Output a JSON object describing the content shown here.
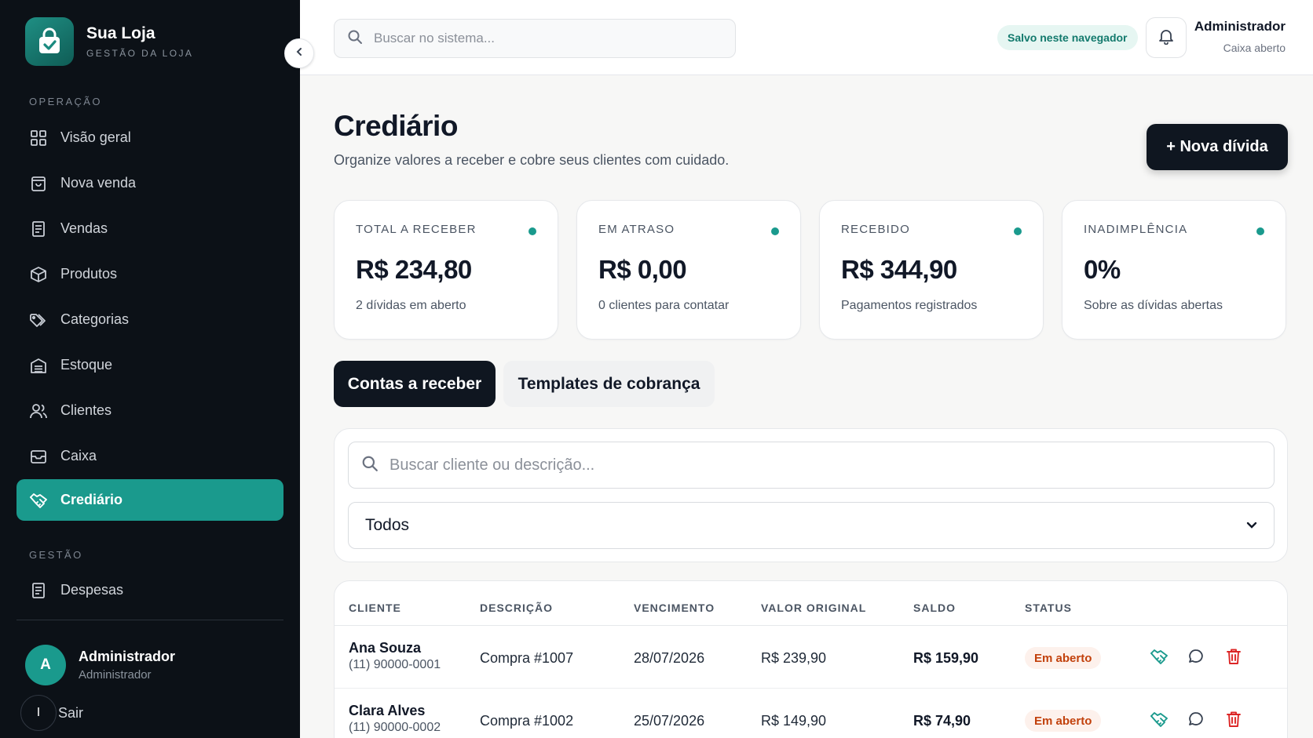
{
  "brand": {
    "name": "Sua Loja",
    "subtitle": "GESTÃO DA LOJA"
  },
  "sidebar": {
    "section_operacao": "OPERAÇÃO",
    "section_gestao": "GESTÃO",
    "items": [
      {
        "label": "Visão geral",
        "icon": "grid-icon"
      },
      {
        "label": "Nova venda",
        "icon": "shopping-bag-icon"
      },
      {
        "label": "Vendas",
        "icon": "receipt-icon"
      },
      {
        "label": "Produtos",
        "icon": "box-icon"
      },
      {
        "label": "Categorias",
        "icon": "tags-icon"
      },
      {
        "label": "Estoque",
        "icon": "warehouse-icon"
      },
      {
        "label": "Clientes",
        "icon": "users-icon"
      },
      {
        "label": "Caixa",
        "icon": "cash-register-icon"
      },
      {
        "label": "Crediário",
        "icon": "handshake-icon",
        "active": true
      }
    ],
    "gestao_items": [
      {
        "label": "Despesas",
        "icon": "receipt-icon"
      }
    ],
    "user": {
      "initial": "A",
      "name": "Administrador",
      "role": "Administrador"
    },
    "logout": {
      "icon_glyph": "I",
      "label": "Sair"
    }
  },
  "topbar": {
    "search_placeholder": "Buscar no sistema...",
    "saved_badge": "Salvo neste navegador",
    "user_name": "Administrador",
    "user_status": "Caixa aberto"
  },
  "page": {
    "title": "Crediário",
    "subtitle": "Organize valores a receber e cobre seus clientes com cuidado.",
    "new_button": "+ Nova dívida"
  },
  "stats": [
    {
      "label": "TOTAL A RECEBER",
      "value": "R$ 234,80",
      "note": "2 dívidas em aberto"
    },
    {
      "label": "EM ATRASO",
      "value": "R$ 0,00",
      "note": "0 clientes para contatar"
    },
    {
      "label": "RECEBIDO",
      "value": "R$ 344,90",
      "note": "Pagamentos registrados"
    },
    {
      "label": "INADIMPLÊNCIA",
      "value": "0%",
      "note": "Sobre as dívidas abertas"
    }
  ],
  "tabs": [
    {
      "label": "Contas a receber",
      "active": true
    },
    {
      "label": "Templates de cobrança",
      "active": false
    }
  ],
  "filters": {
    "search_placeholder": "Buscar cliente ou descrição...",
    "status_selected": "Todos"
  },
  "table": {
    "columns": [
      "CLIENTE",
      "DESCRIÇÃO",
      "VENCIMENTO",
      "VALOR ORIGINAL",
      "SALDO",
      "STATUS"
    ],
    "rows": [
      {
        "client": "Ana Souza",
        "phone": "(11) 90000-0001",
        "description": "Compra #1007",
        "due": "28/07/2026",
        "original": "R$ 239,90",
        "balance": "R$ 159,90",
        "status": "Em aberto"
      },
      {
        "client": "Clara Alves",
        "phone": "(11) 90000-0002",
        "description": "Compra #1002",
        "due": "25/07/2026",
        "original": "R$ 149,90",
        "balance": "R$ 74,90",
        "status": "Em aberto"
      }
    ]
  },
  "colors": {
    "accent": "#1a9a8d",
    "sidebar_bg": "#0c1117",
    "dark_button": "#0f1620",
    "danger": "#dc2626",
    "status_text": "#c2410c"
  }
}
